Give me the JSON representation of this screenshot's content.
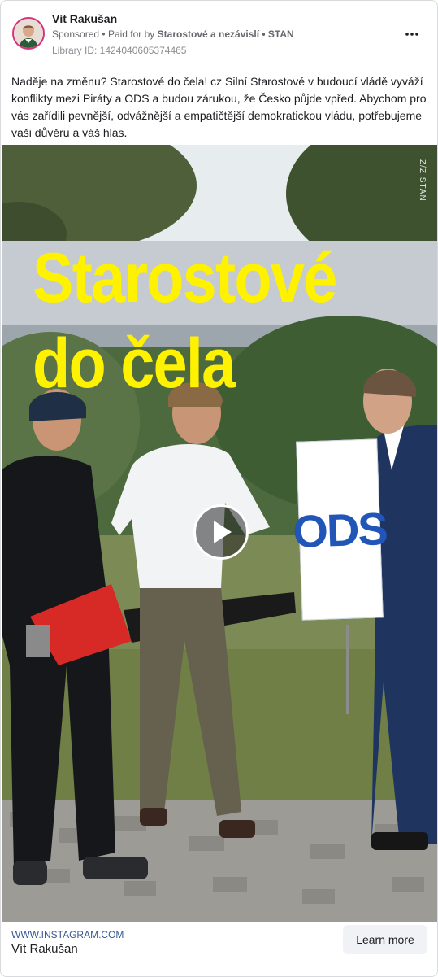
{
  "post": {
    "page_name": "Vít Rakušan",
    "sponsored_label": "Sponsored",
    "separator": "•",
    "paid_for_prefix": "Paid for by",
    "paid_for_entity": "Starostové a nezávislí • STAN",
    "library_id": "Library ID: 1424040605374465",
    "body": "Naděje na změnu? Starostové do čela! cz Silní Starostové v budoucí vládě vyváží konflikty mezi Piráty a ODS a budou zárukou, že Česko půjde vpřed. Abychom pro vás zařídili pevnější, odvážnější a empatičtější demokratickou vládu, potřebujeme vaši důvěru a váš hlas."
  },
  "media": {
    "headline_line1": "Starostové",
    "headline_line2": "do čela",
    "sign_text": "ODS",
    "watermark": "Z/Z STAN"
  },
  "footer": {
    "url": "WWW.INSTAGRAM.COM",
    "title": "Vít Rakušan",
    "cta_label": "Learn more"
  },
  "icons": {
    "more": "more-options-icon",
    "play": "play-icon",
    "avatar": "profile-avatar"
  },
  "colors": {
    "headline": "#fff200",
    "sign_text": "#2156b8",
    "link": "#385898",
    "avatar_ring": "#d4327a"
  }
}
